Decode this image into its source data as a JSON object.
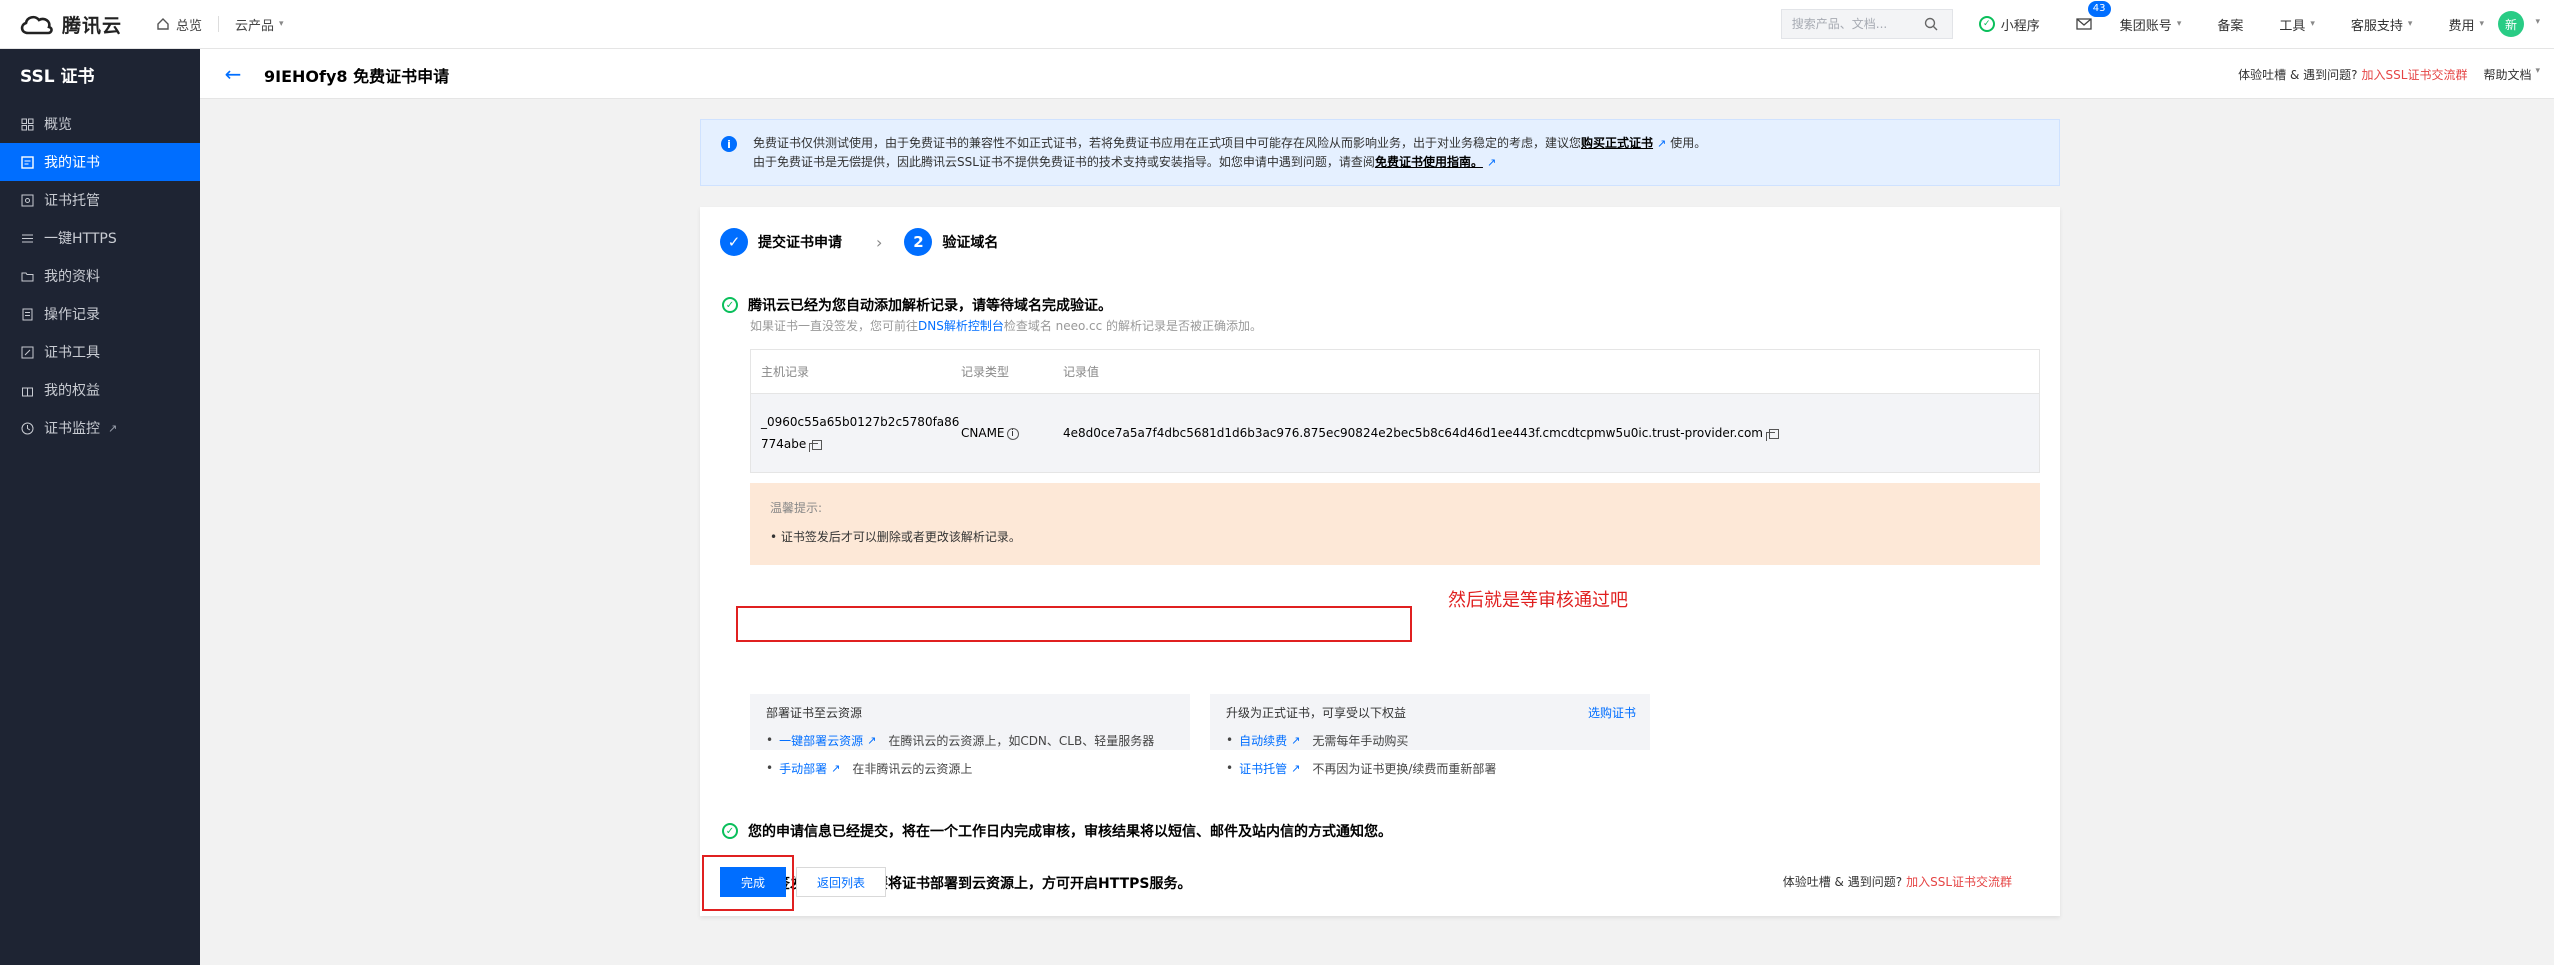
{
  "topbar": {
    "brand": "腾讯云",
    "home": "总览",
    "products": "云产品",
    "search_placeholder": "搜索产品、文档...",
    "mini_program": "小程序",
    "mail_count": "43",
    "account": "集团账号",
    "beian": "备案",
    "tools": "工具",
    "support": "客服支持",
    "billing": "费用",
    "avatar_text": "新"
  },
  "sidebar": {
    "title": "SSL 证书",
    "items": [
      {
        "label": "概览",
        "icon": "dashboard-icon"
      },
      {
        "label": "我的证书",
        "icon": "certificate-icon"
      },
      {
        "label": "证书托管",
        "icon": "hosting-icon"
      },
      {
        "label": "一键HTTPS",
        "icon": "https-icon"
      },
      {
        "label": "我的资料",
        "icon": "folder-icon"
      },
      {
        "label": "操作记录",
        "icon": "log-icon"
      },
      {
        "label": "证书工具",
        "icon": "tool-icon"
      },
      {
        "label": "我的权益",
        "icon": "gift-icon"
      },
      {
        "label": "证书监控",
        "icon": "monitor-icon"
      }
    ]
  },
  "header": {
    "title": "9IEHOfy8 免费证书申请",
    "feedback": "体验吐槽 & 遇到问题?",
    "join_group": "加入SSL证书交流群",
    "help_docs": "帮助文档"
  },
  "banner": {
    "line1_a": "免费证书仅供测试使用，由于免费证书的兼容性不如正式证书，若将免费证书应用在正式项目中可能存在风险从而影响业务，出于对业务稳定的考虑，建议您",
    "line1_link": "购买正式证书",
    "line1_b": "使用。",
    "line2_a": "由于免费证书是无偿提供，因此腾讯云SSL证书不提供免费证书的技术支持或安装指导。如您申请中遇到问题，请查阅",
    "line2_link": "免费证书使用指南。"
  },
  "steps": [
    {
      "label": "提交证书申请",
      "num": "1"
    },
    {
      "label": "验证域名",
      "num": "2"
    }
  ],
  "verify": {
    "title": "腾讯云已经为您自动添加解析记录，请等待域名完成验证。",
    "note_a": "如果证书一直没签发，您可前往",
    "note_link": "DNS解析控制台",
    "note_b": "检查域名 neeo.cc 的解析记录是否被正确添加。",
    "columns": [
      "主机记录",
      "记录类型",
      "记录值"
    ],
    "host_line1": "_0960c55a65b0127b2c5780fa86",
    "host_line2": "774abe",
    "type": "CNAME",
    "value": "4e8d0ce7a5a7f4dbc5681d1d6b3ac976.875ec90824e2bec5b8c64d46d1ee443f.cmcdtcpmw5u0ic.trust-provider.com"
  },
  "tip": {
    "title": "温馨提示:",
    "item": "证书签发后才可以删除或者更改该解析记录。"
  },
  "submitted": {
    "title": "您的申请信息已经提交，将在一个工作日内完成审核，审核结果将以短信、邮件及站内信的方式通知您。",
    "annotation": "然后就是等审核通过吧"
  },
  "deploy": {
    "step_num": "3",
    "title": "证书签发后，您还需要将证书部署到云资源上，方可开启HTTPS服务。",
    "box1_title": "部署证书至云资源",
    "box1_link1": "一键部署云资源",
    "box1_desc1": "在腾讯云的云资源上，如CDN、CLB、轻量服务器",
    "box1_link2": "手动部署",
    "box1_desc2": "在非腾讯云的云资源上",
    "box2_title": "升级为正式证书，可享受以下权益",
    "box2_buy": "选购证书",
    "box2_link1": "自动续费",
    "box2_desc1": "无需每年手动购买",
    "box2_link2": "证书托管",
    "box2_desc2": "不再因为证书更换/续费而重新部署"
  },
  "footer": {
    "finish": "完成",
    "return": "返回列表",
    "feedback": "体验吐槽 & 遇到问题?",
    "join_group": "加入SSL证书交流群"
  }
}
